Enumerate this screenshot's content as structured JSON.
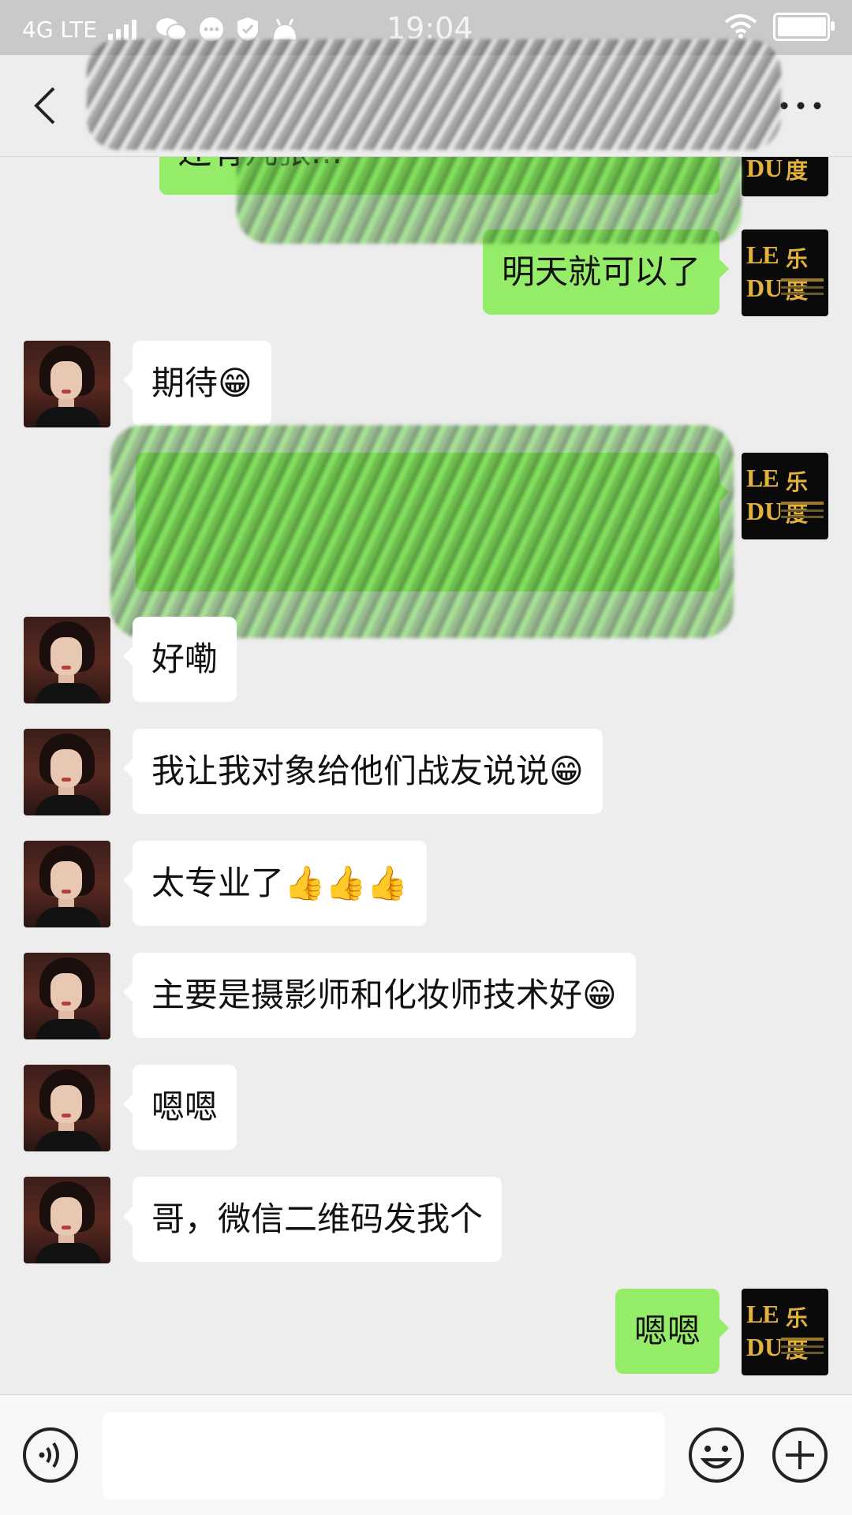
{
  "status_bar": {
    "network": "4G LTE",
    "time": "19:04",
    "battery_level": 0.92
  },
  "header": {
    "back_icon": "chevron-left-icon",
    "more_icon": "more-horizontal-icon"
  },
  "contact_avatar": {
    "brand_line1": "LE",
    "brand_line2": "DU",
    "brand_cn": "乐度"
  },
  "messages": [
    {
      "side": "right",
      "text": "还有几张..."
    },
    {
      "side": "right",
      "text": "明天就可以了"
    },
    {
      "side": "left",
      "text": "期待😁"
    },
    {
      "side": "right",
      "text": ""
    },
    {
      "side": "left",
      "text": "好嘞"
    },
    {
      "side": "left",
      "text": "我让我对象给他们战友说说😁"
    },
    {
      "side": "left",
      "text": "太专业了👍👍👍"
    },
    {
      "side": "left",
      "text": "主要是摄影师和化妆师技术好😁"
    },
    {
      "side": "left",
      "text": "嗯嗯"
    },
    {
      "side": "left",
      "text": "哥，微信二维码发我个"
    },
    {
      "side": "right",
      "text": "嗯嗯"
    }
  ],
  "input_bar": {
    "placeholder": "",
    "voice_icon": "voice-icon",
    "emoji_icon": "emoji-icon",
    "plus_icon": "plus-circle-icon"
  },
  "colors": {
    "sent_bubble": "#95ec69",
    "received_bubble": "#ffffff",
    "background": "#ededed"
  }
}
